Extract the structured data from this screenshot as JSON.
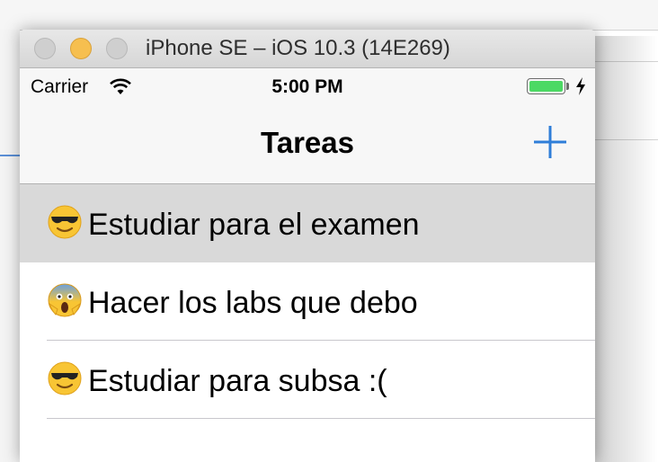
{
  "window": {
    "title": "iPhone SE – iOS 10.3 (14E269)"
  },
  "status_bar": {
    "carrier": "Carrier",
    "time": "5:00 PM",
    "battery_level": 1.0,
    "battery_color": "#4cd964",
    "charging": true
  },
  "nav_bar": {
    "title": "Tareas",
    "add_icon": "plus-icon",
    "tint_color": "#2f7ed8"
  },
  "tasks": [
    {
      "emoji": "sunglasses-face-icon",
      "text": "Estudiar para el examen",
      "selected": true
    },
    {
      "emoji": "screaming-face-icon",
      "text": "Hacer los labs que debo",
      "selected": false
    },
    {
      "emoji": "sunglasses-face-icon",
      "text": "Estudiar para subsa :(",
      "selected": false
    }
  ]
}
